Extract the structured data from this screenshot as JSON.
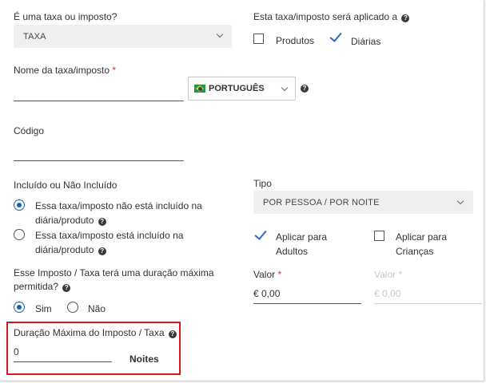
{
  "tax_type": {
    "label": "É uma taxa ou imposto?",
    "selected": "TAXA"
  },
  "applied_to": {
    "label": "Esta taxa/imposto será aplicado a",
    "options": [
      {
        "label": "Produtos",
        "checked": false
      },
      {
        "label": "Diárias",
        "checked": true
      }
    ]
  },
  "name_field": {
    "label": "Nome da taxa/imposto",
    "required_mark": "*",
    "value": ""
  },
  "language": {
    "selected": "PORTUGUÊS",
    "flag_icon": "brazil-flag-icon"
  },
  "code_field": {
    "label": "Código",
    "value": ""
  },
  "included": {
    "label": "Incluído ou Não Incluído",
    "options": [
      {
        "line1": "Essa taxa/imposto não está incluído na",
        "line2": "diária/produto",
        "selected": true
      },
      {
        "line1": "Essa taxa/imposto está incluído na",
        "line2": "diária/produto",
        "selected": false
      }
    ]
  },
  "type": {
    "label": "Tipo",
    "selected": "POR PESSOA / POR NOITE"
  },
  "apply_for": {
    "adults": {
      "line1": "Aplicar para",
      "line2": "Adultos",
      "checked": true
    },
    "children": {
      "line1": "Aplicar para",
      "line2": "Crianças",
      "checked": false
    }
  },
  "value_adults": {
    "label": "Valor",
    "required_mark": "*",
    "value": "€ 0,00"
  },
  "value_children": {
    "label": "Valor",
    "required_mark": "*",
    "value": "€ 0,00",
    "disabled": true
  },
  "max_duration": {
    "label_line1": "Esse Imposto / Taxa terá uma duração máxima",
    "label_line2": "permitida?",
    "options": [
      {
        "label": "Sim",
        "selected": true
      },
      {
        "label": "Não",
        "selected": false
      }
    ]
  },
  "max_duration_field": {
    "label": "Duração Máxima do Imposto / Taxa",
    "value": "0",
    "unit": "Noites"
  },
  "colors": {
    "accent": "#1f5fa8",
    "check": "#2a6ebb",
    "required": "#e0301e",
    "highlight_border": "#d9141c",
    "select_bg": "#efefef"
  },
  "icons": {
    "help": "question-circle-icon",
    "chevron": "chevron-down-icon",
    "check": "checkmark-icon"
  }
}
